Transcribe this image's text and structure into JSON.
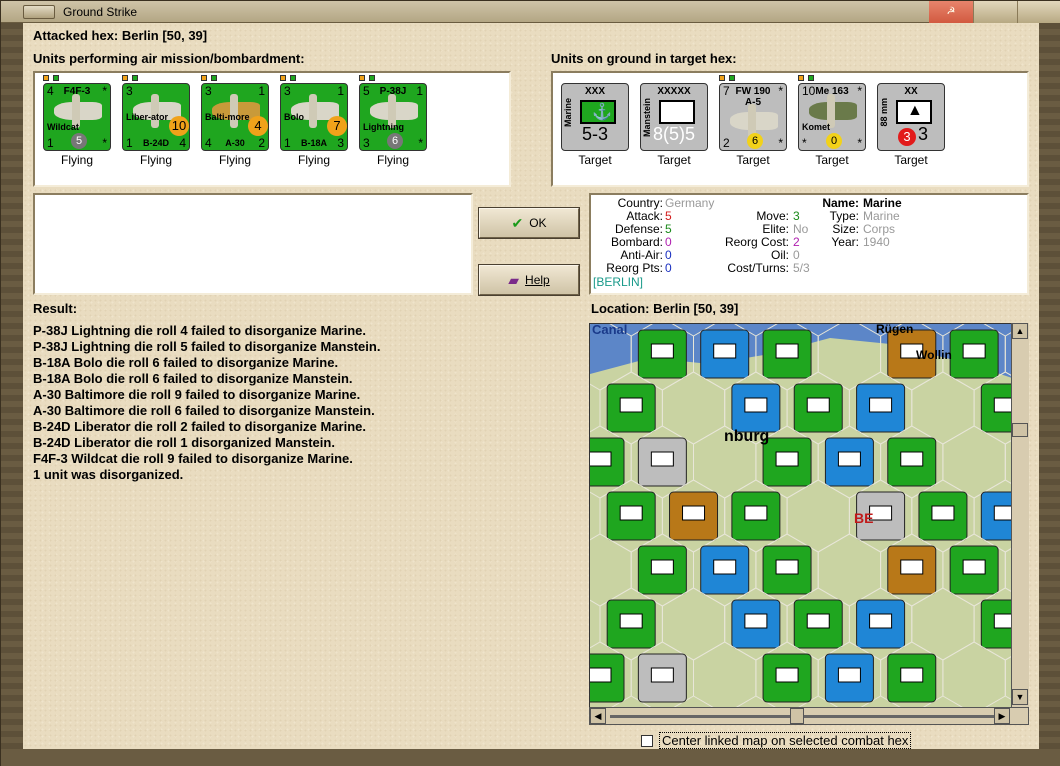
{
  "window": {
    "title": "Ground Strike"
  },
  "attacked_hex": "Attacked hex: Berlin  [50, 39]",
  "air_units_heading": "Units performing air mission/bombardment:",
  "ground_units_heading": "Units on ground in target hex:",
  "air_units": [
    {
      "name": "F4F-3",
      "label": "Wildcat",
      "tl": "4",
      "tr": "*",
      "bl": "1",
      "br": "*",
      "badge": "5",
      "caption": "Flying"
    },
    {
      "name": "",
      "label": "Liber-ator",
      "sub": "B-24D",
      "tl": "3",
      "tr": "",
      "bl": "1",
      "br": "4",
      "badge": "10",
      "caption": "Flying"
    },
    {
      "name": "",
      "label": "Balti-more",
      "sub": "A-30",
      "tl": "3",
      "tr": "1",
      "bl": "4",
      "br": "2",
      "badge": "4",
      "caption": "Flying"
    },
    {
      "name": "",
      "label": "Bolo",
      "sub": "B-18A",
      "tl": "3",
      "tr": "1",
      "bl": "1",
      "br": "3",
      "badge": "7",
      "caption": "Flying"
    },
    {
      "name": "P-38J",
      "label": "Lightning",
      "tl": "5",
      "tr": "1",
      "bl": "3",
      "br": "*",
      "badge": "6",
      "caption": "Flying"
    }
  ],
  "ground_units": [
    {
      "name": "XXX",
      "vert": "Marine",
      "big": "5-3",
      "caption": "Target"
    },
    {
      "name": "XXXXX",
      "vert": "Manstein",
      "big": "8(5)5",
      "caption": "Target"
    },
    {
      "name": "FW 190",
      "sub": "A-5",
      "tl": "7",
      "tr": "*",
      "bl": "2",
      "br": "*",
      "badge": "6",
      "caption": "Target"
    },
    {
      "name": "Me 163",
      "label": "Komet",
      "tl": "10",
      "tr": "*",
      "bl": "*",
      "br": "*",
      "badge": "0",
      "caption": "Target"
    },
    {
      "name": "XX",
      "vert": "88 mm",
      "big": "3",
      "badge": "3",
      "caption": "Target"
    }
  ],
  "buttons": {
    "ok": "OK",
    "help": "Help"
  },
  "info": {
    "country_k": "Country:",
    "country_v": "Germany",
    "attack_k": "Attack:",
    "attack_v": "5",
    "defense_k": "Defense:",
    "defense_v": "5",
    "bombard_k": "Bombard:",
    "bombard_v": "0",
    "antiair_k": "Anti-Air:",
    "antiair_v": "0",
    "reorgpts_k": "Reorg Pts:",
    "reorgpts_v": "0",
    "move_k": "Move:",
    "move_v": "3",
    "elite_k": "Elite:",
    "elite_v": "No",
    "reorgcost_k": "Reorg Cost:",
    "reorgcost_v": "2",
    "oil_k": "Oil:",
    "oil_v": "0",
    "costturns_k": "Cost/Turns:",
    "costturns_v": "5/3",
    "name_k": "Name:",
    "name_v": "Marine",
    "type_k": "Type:",
    "type_v": "Marine",
    "size_k": "Size:",
    "size_v": "Corps",
    "year_k": "Year:",
    "year_v": "1940",
    "location": "[BERLIN]"
  },
  "result_heading": "Result:",
  "results": [
    "P-38J Lightning die roll 4 failed to disorganize Marine.",
    "P-38J Lightning die roll 5 failed to disorganize Manstein.",
    "B-18A Bolo die roll 6 failed to disorganize Marine.",
    "B-18A Bolo die roll 6 failed to disorganize Manstein.",
    "A-30 Baltimore die roll 9 failed to disorganize Marine.",
    "A-30 Baltimore die roll 6 failed to disorganize Manstein.",
    "B-24D Liberator die roll 2 failed to disorganize Marine.",
    "B-24D Liberator die roll 1 disorganized Manstein.",
    "F4F-3 Wildcat die roll 9 failed to disorganize Marine.",
    "1 unit was disorganized."
  ],
  "location_heading": "Location:  Berlin  [50, 39]",
  "map_labels": [
    "Canal",
    "Rügen",
    "Wollin",
    "nburg",
    "BE"
  ],
  "checkbox_label": "Center linked map on selected combat hex",
  "colors": {
    "green": "#1fa61f",
    "blue": "#1f86d6",
    "brown": "#b87818",
    "grey": "#bdbdbd"
  }
}
